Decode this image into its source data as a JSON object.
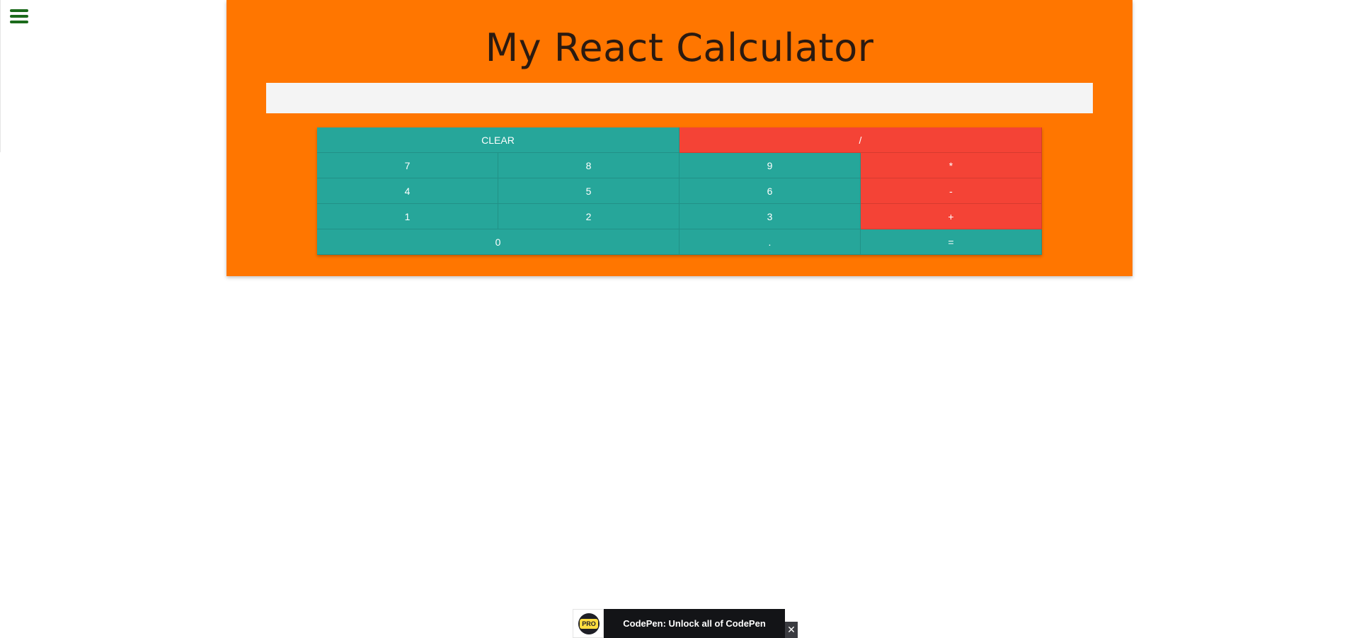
{
  "app": {
    "title": "My React Calculator",
    "display_value": "",
    "colors": {
      "background": "#ff7600",
      "number_key": "#26a69a",
      "operator_key": "#f44336",
      "display": "#f4f4f4",
      "menu_icon": "#1b6a1b"
    }
  },
  "menu": {
    "icon": "hamburger-menu-icon"
  },
  "keypad": {
    "clear": "CLEAR",
    "divide": "/",
    "seven": "7",
    "eight": "8",
    "nine": "9",
    "multiply": "*",
    "four": "4",
    "five": "5",
    "six": "6",
    "subtract": "-",
    "one": "1",
    "two": "2",
    "three": "3",
    "add": "+",
    "zero": "0",
    "decimal": ".",
    "equals": "="
  },
  "promo": {
    "badge": "PRO",
    "text": "CodePen: Unlock all of CodePen",
    "close": "✕"
  }
}
